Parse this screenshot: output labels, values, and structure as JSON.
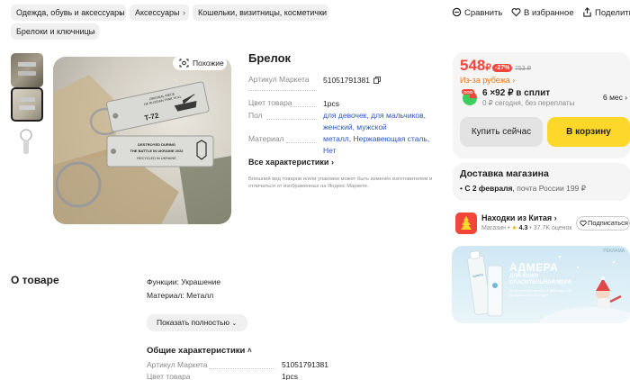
{
  "breadcrumbs": [
    "Одежда, обувь и аксессуары",
    "Аксессуары",
    "Кошельки, визитницы, косметички",
    "Брелоки и ключницы"
  ],
  "top_actions": {
    "compare": "Сравнить",
    "favorites": "В избранное",
    "share": "Поделиться"
  },
  "gallery": {
    "similar_label": "Похожие",
    "tag_lines": [
      "ORIGINAL PIECE",
      "OF RUSSIAN TANK HULL",
      "T-72",
      "DESTROYED DURING",
      "THE BATTLE IN UKRAINE 2022",
      "RECYCLED IN UKRAINE"
    ]
  },
  "product": {
    "title": "Брелок",
    "specs": [
      {
        "label": "Артикул Маркета",
        "value": "51051791381"
      },
      {
        "label": "Цвет товара",
        "value": "1pcs"
      },
      {
        "label": "Пол",
        "value_lines": [
          "для девочек, для мальчиков,",
          "женский, мужской"
        ]
      },
      {
        "label": "Материал",
        "value_lines": [
          "металл, Нержавеющая сталь,",
          "Нет"
        ]
      }
    ],
    "all_chars": "Все характеристики",
    "disclaimer": "Внешний вид товаров и/или упаковки может быть изменён изготовителем и отличаться от изображенных на Яндекс Маркете."
  },
  "buy": {
    "price": "548",
    "currency": "₽",
    "discount": "-27%",
    "old_price": "753 ₽",
    "abroad": "Из-за рубежа",
    "split_badge": "ООО",
    "split_amount": "6 ×92 ₽ в сплит",
    "split_sub": "0 ₽ сегодня, без переплаты",
    "split_months": "6 мес",
    "buy_now": "Купить сейчас",
    "to_cart": "В корзину"
  },
  "delivery": {
    "title": "Доставка магазина",
    "date": "С 2 февраля",
    "method": "почта России",
    "price": "199 ₽"
  },
  "shop": {
    "name": "Находки из Китая",
    "type": "Магазин",
    "rating": "4.3",
    "reviews": "37.7K оценок",
    "subscribe": "Подписаться"
  },
  "ad": {
    "label": "РЕКЛАМА",
    "brand": "АДМЕРА",
    "line1": "ДЛЯ КОЖИ",
    "line2": "СПАСИТЕЛЬНАЯ МЕРА",
    "small": "Не просто увлажняет, а действует на причины сухости кожи*"
  },
  "about": {
    "title": "О товаре",
    "features": [
      "Функции: Украшение",
      "Материал: Металл"
    ],
    "show_full": "Показать полностью",
    "general_title": "Общие характеристики",
    "general": [
      {
        "label": "Артикул Маркета",
        "value": "51051791381"
      },
      {
        "label": "Цвет товара",
        "value": "1pcs"
      }
    ]
  },
  "colors": {
    "price_red": "#f2463b",
    "abroad_orange": "#e6791a",
    "cart_yellow": "#fdd82b",
    "link_blue": "#2d56c4"
  }
}
